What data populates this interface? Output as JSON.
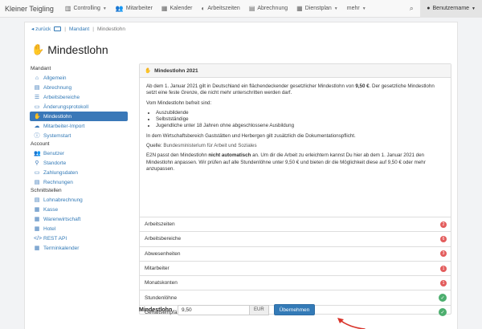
{
  "nav": {
    "brand": "Kleiner Teigling",
    "items": [
      {
        "label": "Controlling",
        "icon": "chart-icon",
        "glyph": "▥",
        "dropdown": true
      },
      {
        "label": "Mitarbeiter",
        "icon": "users-icon",
        "glyph": "👥",
        "dropdown": false
      },
      {
        "label": "Kalender",
        "icon": "calendar-icon",
        "glyph": "▦",
        "dropdown": false
      },
      {
        "label": "Arbeitszeiten",
        "icon": "time-icon",
        "glyph": "◐",
        "dropdown": false
      },
      {
        "label": "Abrechnung",
        "icon": "billing-icon",
        "glyph": "▤",
        "dropdown": false
      },
      {
        "label": "Dienstplan",
        "icon": "schedule-icon",
        "glyph": "▦",
        "dropdown": true
      },
      {
        "label": "mehr",
        "icon": "",
        "glyph": "",
        "dropdown": true
      }
    ],
    "user_label": "Benutzername"
  },
  "breadcrumb": {
    "back": "zurück",
    "parent": "Mandant",
    "current": "Mindestlohn"
  },
  "page_title": "Mindestlohn",
  "sidebar": {
    "sections": [
      {
        "heading": "Mandant",
        "items": [
          {
            "label": "Allgemein",
            "icon": "home-icon",
            "glyph": "⌂"
          },
          {
            "label": "Abrechnung",
            "icon": "billing-icon",
            "glyph": "▤"
          },
          {
            "label": "Arbeitsbereiche",
            "icon": "layers-icon",
            "glyph": "☰"
          },
          {
            "label": "Änderungsprotokoll",
            "icon": "log-icon",
            "glyph": "▭"
          },
          {
            "label": "Mindestlohn",
            "icon": "money-hand-icon",
            "glyph": "✋",
            "active": true
          },
          {
            "label": "Mitarbeiter-Import",
            "icon": "cloud-upload-icon",
            "glyph": "☁"
          },
          {
            "label": "Systemstart",
            "icon": "info-icon",
            "glyph": "ⓘ"
          }
        ]
      },
      {
        "heading": "Account",
        "items": [
          {
            "label": "Benutzer",
            "icon": "users-icon",
            "glyph": "👥"
          },
          {
            "label": "Standorte",
            "icon": "location-icon",
            "glyph": "⚲"
          },
          {
            "label": "Zahlungsdaten",
            "icon": "card-icon",
            "glyph": "▭"
          },
          {
            "label": "Rechnungen",
            "icon": "invoice-icon",
            "glyph": "▤"
          }
        ]
      },
      {
        "heading": "Schnittstellen",
        "items": [
          {
            "label": "Lohnabrechnung",
            "icon": "payroll-icon",
            "glyph": "▤"
          },
          {
            "label": "Kasse",
            "icon": "register-icon",
            "glyph": "▦"
          },
          {
            "label": "Warenwirtschaft",
            "icon": "inventory-icon",
            "glyph": "▦"
          },
          {
            "label": "Hotel",
            "icon": "hotel-icon",
            "glyph": "▦"
          },
          {
            "label": "REST API",
            "icon": "code-icon",
            "glyph": "</>"
          },
          {
            "label": "Terminkalender",
            "icon": "calendar-icon",
            "glyph": "▦"
          }
        ]
      }
    ]
  },
  "panel": {
    "title": "Mindestlohn 2021",
    "intro_a": "Ab dem 1. Januar 2021 gilt in Deutschland ein flächendeckender gesetzlicher Mindestlohn von ",
    "intro_b": "9,50 €",
    "intro_c": ". Der gesetzliche Mindestlohn setzt eine feste Grenze, die nicht mehr unterschritten werden darf.",
    "exempt_heading": "Vom Mindestlohn befreit sind:",
    "exempt_list": [
      "Auszubildende",
      "Selbstständige",
      "Jugendliche unter 18 Jahren ohne abgeschlossene Ausbildung"
    ],
    "docs_note": "In dem Wirtschaftsbereich Gaststätten und Herbergen gilt zusätzlich die Dokumentationspflicht.",
    "source_label": "Quelle:",
    "source_value": "Bundesministerium für Arbeit und Soziales",
    "e2n_a": "E2N passt den Mindestlohn ",
    "e2n_b": "nicht automatisch",
    "e2n_c": " an. Um dir die Arbeit zu erleichtern kannst Du hier ab dem 1. Januar 2021 den Mindestlohn anpassen. Wir prüfen auf alle Stundenlöhne unter 9,50 € und bieten dir die Möglichkeit diese auf 9,50 € oder mehr anzupassen."
  },
  "checks": [
    {
      "label": "Arbeitszeiten",
      "count": "2",
      "status": "error"
    },
    {
      "label": "Arbeitsbereiche",
      "count": "6",
      "status": "error"
    },
    {
      "label": "Abwesenheiten",
      "count": "3",
      "status": "error"
    },
    {
      "label": "Mitarbeiter",
      "count": "1",
      "status": "error"
    },
    {
      "label": "Monatskonten",
      "count": "1",
      "status": "error"
    },
    {
      "label": "Stundenlöhne",
      "count": "",
      "status": "ok"
    },
    {
      "label": "Gehaltsempfänger",
      "count": "",
      "status": "ok"
    }
  ],
  "form": {
    "label": "Mindestlohn",
    "value": "9,50",
    "unit": "EUR",
    "submit_label": "Übernehmen"
  },
  "colors": {
    "accent": "#337ab7",
    "error": "#e35d5d",
    "ok": "#4cae6e",
    "arrow": "#d9342b"
  }
}
